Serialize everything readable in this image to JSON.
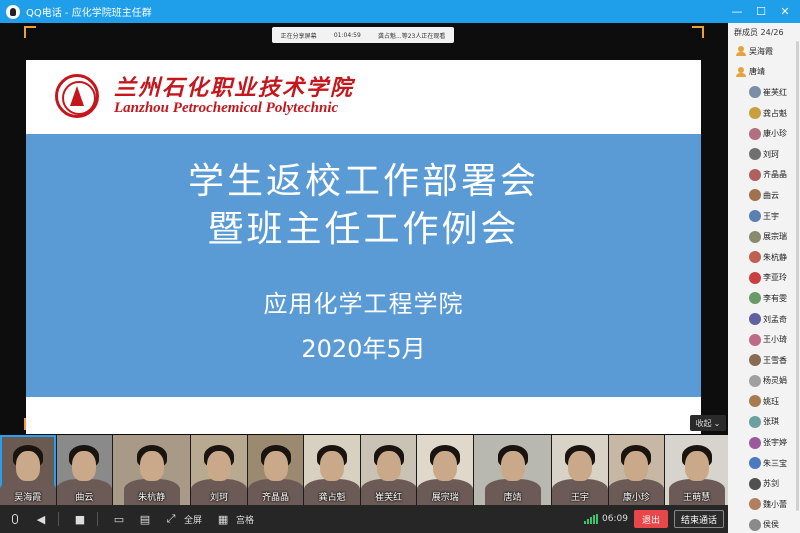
{
  "window": {
    "title": "QQ电话 - 应化学院班主任群",
    "icons": [
      "qq-logo-icon",
      "minimize-icon",
      "maximize-icon",
      "close-icon"
    ]
  },
  "share_bar": {
    "status": "正在分享屏幕",
    "time": "01:04:59",
    "viewers": "龚占魁...等23人正在观看"
  },
  "slide": {
    "school_cn": "兰州石化职业技术学院",
    "school_en": "Lanzhou Petrochemical Polytechnic",
    "line1": "学生返校工作部署会",
    "line2": "暨班主任工作例会",
    "line3": "应用化学工程学院",
    "line4": "2020年5月",
    "colors": {
      "header_red": "#c4161c",
      "body_blue": "#5b9bd5"
    }
  },
  "collapse_label": "收起",
  "thumbnails": [
    {
      "name": "吴海霞",
      "bg": "#6a5a52",
      "active": true
    },
    {
      "name": "曲云",
      "bg": "#8a8a8a",
      "active": false
    },
    {
      "name": "朱杭静",
      "bg": "#a89a86",
      "active": false
    },
    {
      "name": "刘珂",
      "bg": "#b8aa90",
      "active": false
    },
    {
      "name": "齐晶晶",
      "bg": "#9c8a70",
      "active": false
    },
    {
      "name": "龚占魁",
      "bg": "#d8d0c0",
      "active": false
    },
    {
      "name": "崔芙红",
      "bg": "#c9c2b5",
      "active": false
    },
    {
      "name": "展宗瑞",
      "bg": "#e0d8ca",
      "active": false
    },
    {
      "name": "唐靖",
      "bg": "#b9b8b0",
      "active": false
    },
    {
      "name": "王宇",
      "bg": "#d9d2c6",
      "active": false
    },
    {
      "name": "康小珍",
      "bg": "#c6b8a4",
      "active": false
    },
    {
      "name": "王萌慧",
      "bg": "#d7d4ce",
      "active": false
    }
  ],
  "toolbar": {
    "fullscreen_label": "全屏",
    "grid_label": "宫格",
    "timer": "06:09",
    "exit_label": "退出",
    "end_label": "结束通话",
    "icons": [
      "microphone-icon",
      "speaker-icon",
      "camera-icon",
      "screen-share-icon",
      "whiteboard-icon",
      "fullscreen-icon",
      "grid-icon",
      "signal-icon"
    ]
  },
  "members": {
    "header": "群成员 24/26",
    "list": [
      {
        "name": "吴海霞",
        "type": "person",
        "color": "#e6a23c"
      },
      {
        "name": "唐靖",
        "type": "person",
        "color": "#e6a23c"
      },
      {
        "name": "崔芙红",
        "type": "avatar",
        "color": "#7a8ea8"
      },
      {
        "name": "龚占魁",
        "type": "avatar",
        "color": "#c8a040"
      },
      {
        "name": "康小珍",
        "type": "avatar",
        "color": "#b07080"
      },
      {
        "name": "刘珂",
        "type": "avatar",
        "color": "#707070"
      },
      {
        "name": "齐晶晶",
        "type": "avatar",
        "color": "#b06060"
      },
      {
        "name": "曲云",
        "type": "avatar",
        "color": "#a07050"
      },
      {
        "name": "王宇",
        "type": "avatar",
        "color": "#5a7fb0"
      },
      {
        "name": "展宗瑞",
        "type": "avatar",
        "color": "#8a8a70"
      },
      {
        "name": "朱杭静",
        "type": "avatar",
        "color": "#c06050"
      },
      {
        "name": "李亚玲",
        "type": "avatar",
        "color": "#c84040"
      },
      {
        "name": "李有雯",
        "type": "avatar",
        "color": "#6a9a6a"
      },
      {
        "name": "刘孟奇",
        "type": "avatar",
        "color": "#6060a0"
      },
      {
        "name": "王小琦",
        "type": "avatar",
        "color": "#c06a8a"
      },
      {
        "name": "王雪香",
        "type": "avatar",
        "color": "#8a6a50"
      },
      {
        "name": "杨灵娟",
        "type": "avatar",
        "color": "#a0a0a0"
      },
      {
        "name": "姚珏",
        "type": "avatar",
        "color": "#a87a50"
      },
      {
        "name": "张琪",
        "type": "avatar",
        "color": "#6aa0a0"
      },
      {
        "name": "张宇婷",
        "type": "avatar",
        "color": "#9a5a9a"
      },
      {
        "name": "朱三宝",
        "type": "avatar",
        "color": "#4a7ac0"
      },
      {
        "name": "苏剑",
        "type": "avatar",
        "color": "#505050"
      },
      {
        "name": "魏小蕾",
        "type": "avatar",
        "color": "#b08060"
      },
      {
        "name": "侯侯",
        "type": "avatar",
        "color": "#8a8a8a"
      }
    ]
  }
}
